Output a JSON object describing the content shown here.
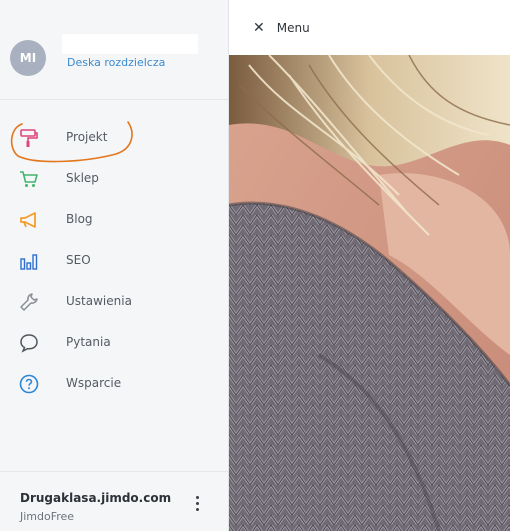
{
  "account": {
    "initials": "MI",
    "dashboard_link": "Deska rozdzielcza"
  },
  "topbar": {
    "close_icon": "close-icon",
    "menu_label": "Menu"
  },
  "nav": [
    {
      "label": "Projekt",
      "icon": "paint-roller-icon",
      "color": "#e0457b"
    },
    {
      "label": "Sklep",
      "icon": "cart-icon",
      "color": "#43b36d"
    },
    {
      "label": "Blog",
      "icon": "megaphone-icon",
      "color": "#f39c25"
    },
    {
      "label": "SEO",
      "icon": "bar-chart-icon",
      "color": "#2f6fd1"
    },
    {
      "label": "Ustawienia",
      "icon": "wrench-icon",
      "color": "#8a8f96"
    },
    {
      "label": "Pytania",
      "icon": "speech-bubble-icon",
      "color": "#50565e"
    },
    {
      "label": "Wsparcie",
      "icon": "help-circle-icon",
      "color": "#2e86d6"
    }
  ],
  "site": {
    "domain": "Drugaklasa.jimdo.com",
    "plan": "JimdoFree"
  },
  "annotation_color": "#e2771d"
}
